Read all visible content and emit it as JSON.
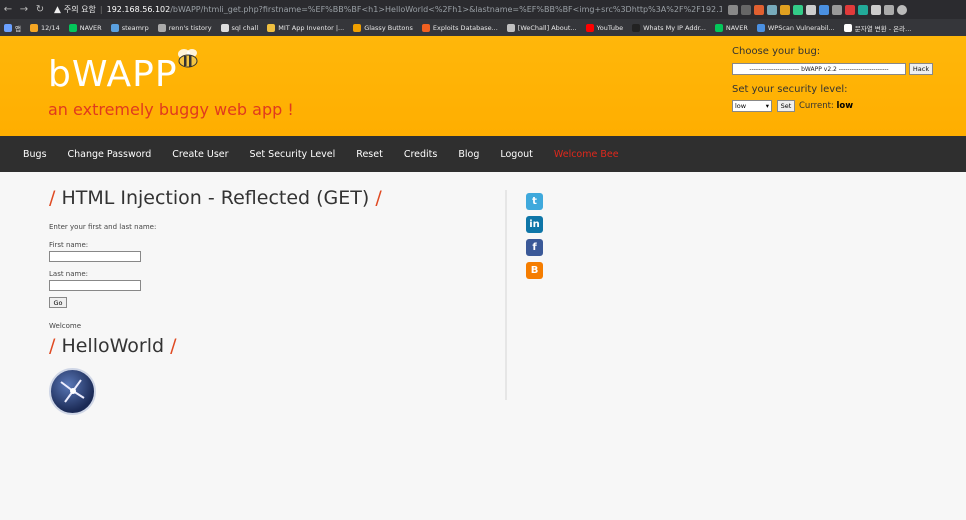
{
  "browser": {
    "security_text": "주의 요함",
    "url_host": "192.168.56.102",
    "url_path": "/bWAPP/htmli_get.php?firstname=%EF%BB%BF<h1>HelloWorld<%2Fh1>&lastname=%EF%BB%BF<img+src%3Dhttp%3A%2F%2F192.168.56.102%2FbWAPP%2Fimages%2..."
  },
  "bookmarks": [
    {
      "label": "앱",
      "color": "#6aa0ff"
    },
    {
      "label": "12/14",
      "color": "#f5a623"
    },
    {
      "label": "NAVER",
      "color": "#03c75a"
    },
    {
      "label": "steamrp",
      "color": "#5aa0e0"
    },
    {
      "label": "renn's tistory",
      "color": "#aaaaaa"
    },
    {
      "label": "sql chall",
      "color": "#dddddd"
    },
    {
      "label": "MIT App Inventor |...",
      "color": "#f0c040"
    },
    {
      "label": "Glassy Buttons",
      "color": "#f0a000"
    },
    {
      "label": "Exploits Database...",
      "color": "#f06020"
    },
    {
      "label": "[WeChall] About...",
      "color": "#c0c0c0"
    },
    {
      "label": "YouTube",
      "color": "#ff0000"
    },
    {
      "label": "Whats My IP Addr...",
      "color": "#222222"
    },
    {
      "label": "NAVER",
      "color": "#03c75a"
    },
    {
      "label": "WPScan Vulnerabil...",
      "color": "#4a90e2"
    },
    {
      "label": "문자열 변환 - 온라...",
      "color": "#ffffff"
    }
  ],
  "header": {
    "logo": "bWAPP",
    "tagline": "an extremely buggy web app !",
    "choose_bug_label": "Choose your bug:",
    "bug_select_value": "----------------------- bWAPP v2.2 -----------------------",
    "hack_button": "Hack",
    "security_label": "Set your security level:",
    "security_value": "low",
    "set_button": "Set",
    "current_prefix": "Current:",
    "current_value": "low"
  },
  "menu": [
    "Bugs",
    "Change Password",
    "Create User",
    "Set Security Level",
    "Reset",
    "Credits",
    "Blog",
    "Logout"
  ],
  "menu_welcome": "Welcome Bee",
  "main": {
    "title": "HTML Injection - Reflected (GET)",
    "slash": "/",
    "intro": "Enter your first and last name:",
    "first_name_label": "First name:",
    "last_name_label": "Last name:",
    "go_button": "Go",
    "welcome_text": "Welcome",
    "injected_heading": "HelloWorld"
  },
  "social": [
    {
      "name": "twitter",
      "glyph": "t",
      "color": "#3fa9dc"
    },
    {
      "name": "linkedin",
      "glyph": "in",
      "color": "#0e76a8"
    },
    {
      "name": "facebook",
      "glyph": "f",
      "color": "#3b5998"
    },
    {
      "name": "blogger",
      "glyph": "B",
      "color": "#f57d00"
    }
  ]
}
